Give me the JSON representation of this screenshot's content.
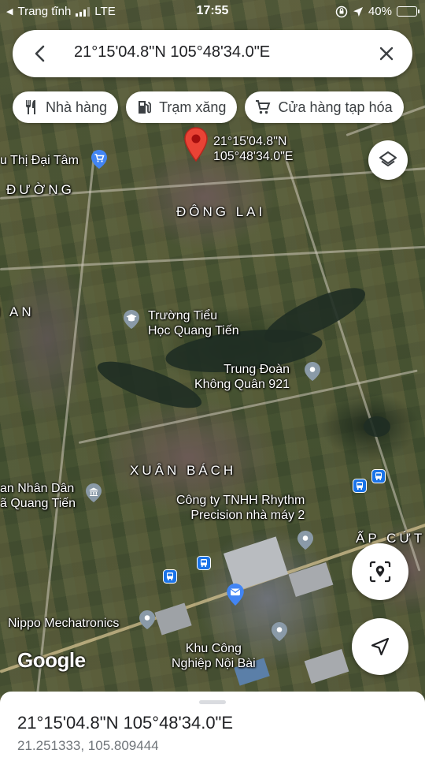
{
  "status_bar": {
    "back_label": "Trang tĩnh",
    "network": "LTE",
    "time": "17:55",
    "battery": "40%",
    "battery_level": 0.4
  },
  "search": {
    "query": "21°15'04.8\"N 105°48'34.0\"E"
  },
  "chips": [
    {
      "label": "Nhà hàng",
      "icon": "restaurant-icon"
    },
    {
      "label": "Trạm xăng",
      "icon": "gas-station-icon"
    },
    {
      "label": "Cửa hàng tạp hóa",
      "icon": "shopping-cart-icon"
    }
  ],
  "map": {
    "pin_label_line1": "21°15'04.8\"N",
    "pin_label_line2": "105°48'34.0\"E",
    "areas": {
      "dong_lai": "ĐÔNG LAI",
      "duong": "ĐƯỜNG",
      "an": "N AN",
      "xuan_bach": "XUÂN BÁCH",
      "ap_cut": "ẤP CỨT"
    },
    "places": {
      "sieu_thi": "u Thị Đại Tâm",
      "truong_line1": "Trường Tiểu",
      "truong_line2": "Học Quang Tiến",
      "trung_doan_line1": "Trung Đoàn",
      "trung_doan_line2": "Không Quân 921",
      "uy_ban_line1": "an Nhân Dân",
      "uy_ban_line2": "ã Quang Tiến",
      "rhythm_line1": "Công ty TNHH Rhythm",
      "rhythm_line2": "Precision nhà máy 2",
      "nippo": "Nippo Mechatronics",
      "kcn_line1": "Khu Công",
      "kcn_line2": "Nghiệp Nội Bài"
    },
    "attribution": "Google"
  },
  "bottom_sheet": {
    "title": "21°15'04.8\"N 105°48'34.0\"E",
    "decimal_coords": "21.251333, 105.809444"
  },
  "colors": {
    "pin": "#ea4335",
    "poi_gray": "#8a9aa8",
    "poi_blue": "#4285f4",
    "bus_blue": "#1a73e8"
  }
}
